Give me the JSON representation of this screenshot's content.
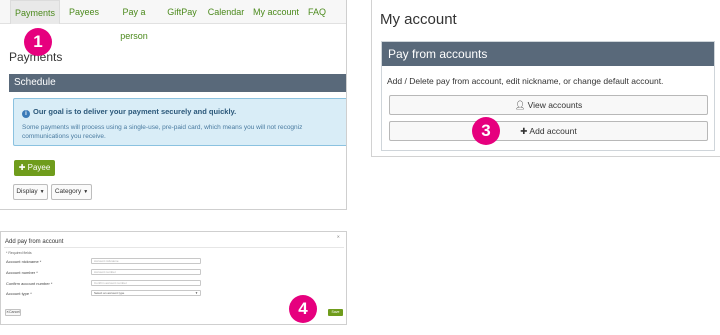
{
  "nav": {
    "items": [
      {
        "label": "Payments"
      },
      {
        "label": "Payees"
      },
      {
        "label": "Pay a person"
      },
      {
        "label": "GiftPay"
      },
      {
        "label": "Calendar"
      },
      {
        "label": "My account"
      },
      {
        "label": "FAQ"
      }
    ],
    "active": "Payments"
  },
  "payments": {
    "title": "Payments",
    "schedule_header": "Schedule",
    "info_title": "Our goal is to deliver your payment securely and quickly.",
    "info_line1": "Some payments will process using a single-use, pre-paid card, which means you will not recogniz",
    "info_line2": "communications you receive.",
    "payee_button": "Payee",
    "display_button": "Display",
    "category_button": "Category"
  },
  "my_account": {
    "title": "My account",
    "section_header": "Pay from accounts",
    "description": "Add / Delete pay from account, edit nickname, or change default account.",
    "view_accounts_button": "View accounts",
    "add_account_button": "Add account"
  },
  "add_account_form": {
    "title": "Add pay from account",
    "required_note": "* Required fields",
    "fields": [
      {
        "label": "Account nickname *",
        "placeholder": "Account nickname"
      },
      {
        "label": "Account number *",
        "placeholder": "Account number"
      },
      {
        "label": "Confirm account number *",
        "placeholder": "Confirm account number"
      }
    ],
    "account_type_label": "Account type *",
    "account_type_value": "Select an account type",
    "cancel_button": "Cancel",
    "save_button": "Save"
  },
  "step_badges": [
    "1",
    "3",
    "4"
  ],
  "colors": {
    "brand_green": "#6f9c1c",
    "nav_green": "#4c8a1d",
    "header_slate": "#59697a",
    "badge_pink": "#e6007e",
    "info_bg": "#d9edf7"
  }
}
